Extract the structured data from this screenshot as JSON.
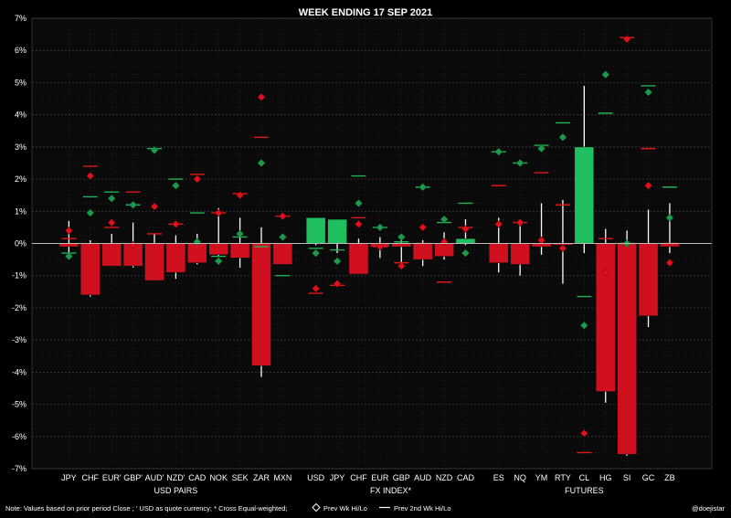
{
  "chart_data": {
    "type": "bar",
    "title": "WEEK ENDING  17 SEP 2021",
    "ylim": [
      -7,
      7
    ],
    "ytick_labels": [
      "-7%",
      "-6%",
      "-5%",
      "-4%",
      "-3%",
      "-2%",
      "-1%",
      "0%",
      "1%",
      "2%",
      "3%",
      "4%",
      "5%",
      "6%",
      "7%"
    ],
    "grid": true,
    "colors": {
      "up": "#1fbf5f",
      "down": "#d0101e",
      "diamond_up": "#1f9a4a",
      "diamond_down": "#e0101e",
      "background": "#000000",
      "plot": "#0a0a0a"
    },
    "groups": [
      {
        "label": "USD PAIRS",
        "categories": [
          "JPY",
          "CHF",
          "EUR'",
          "GBP'",
          "AUD'",
          "NZD'",
          "CAD",
          "NOK",
          "SEK",
          "ZAR",
          "MXN"
        ],
        "values": [
          -0.1,
          -1.6,
          -0.7,
          -0.7,
          -1.15,
          -0.9,
          -0.6,
          -0.35,
          -0.45,
          -3.8,
          -0.65
        ],
        "range_high": [
          0.7,
          0.1,
          0.3,
          0.65,
          0.3,
          0.25,
          0.3,
          1.1,
          0.8,
          0.5,
          0.0
        ],
        "range_low": [
          -0.3,
          -1.65,
          -0.7,
          -0.75,
          -1.15,
          -1.1,
          -0.65,
          -0.4,
          -0.75,
          -4.15,
          -0.65
        ],
        "prev_wk_high": [
          0.4,
          2.1,
          0.65,
          -0.05,
          1.15,
          0.6,
          2.0,
          0.95,
          1.5,
          4.55,
          0.85
        ],
        "prev_wk_low": [
          -0.4,
          0.95,
          1.4,
          1.2,
          2.9,
          1.8,
          0.05,
          -0.55,
          0.3,
          2.5,
          0.2
        ],
        "prev_2nd_wk_high": [
          0.15,
          2.4,
          0.5,
          1.6,
          0.3,
          0.6,
          2.15,
          0.95,
          1.55,
          3.3,
          0.85
        ],
        "prev_2nd_wk_low": [
          -0.3,
          1.45,
          1.6,
          1.2,
          2.95,
          2.0,
          0.95,
          -0.4,
          0.2,
          -0.1,
          -1.0
        ]
      },
      {
        "label": "FX INDEX*",
        "categories": [
          "USD",
          "JPY",
          "CHF",
          "EUR",
          "GBP",
          "AUD",
          "NZD",
          "CAD"
        ],
        "values": [
          0.8,
          0.75,
          -0.95,
          -0.1,
          -0.1,
          -0.5,
          -0.4,
          0.15
        ],
        "range_high": [
          0.8,
          0.75,
          0.15,
          0.2,
          0.2,
          0.1,
          0.35,
          0.75
        ],
        "range_low": [
          -0.05,
          -0.3,
          -0.95,
          -0.45,
          -0.75,
          -0.7,
          -0.5,
          -0.05
        ],
        "prev_wk_high": [
          -1.4,
          -1.25,
          0.6,
          -0.1,
          -0.7,
          0.5,
          0.05,
          0.45
        ],
        "prev_wk_low": [
          -0.3,
          -0.55,
          1.25,
          0.5,
          0.2,
          1.75,
          0.75,
          -0.3
        ],
        "prev_2nd_wk_high": [
          -1.55,
          -1.3,
          0.8,
          -0.1,
          -0.6,
          0.0,
          -1.2,
          0.5
        ],
        "prev_2nd_wk_low": [
          -0.15,
          -0.2,
          2.1,
          0.5,
          0.05,
          1.75,
          0.65,
          1.25
        ]
      },
      {
        "label": "FUTURES",
        "categories": [
          "ES",
          "NQ",
          "YM",
          "RTY",
          "CL",
          "HG",
          "SI",
          "GC",
          "ZB"
        ],
        "values": [
          -0.6,
          -0.65,
          -0.1,
          -0.05,
          3.0,
          -4.6,
          -6.55,
          -2.25,
          -0.1
        ],
        "range_high": [
          0.8,
          0.65,
          1.25,
          1.35,
          4.9,
          0.45,
          0.4,
          1.05,
          1.25
        ],
        "range_low": [
          -0.9,
          -1.0,
          -0.35,
          -1.25,
          -0.3,
          -4.95,
          -6.6,
          -2.6,
          -0.3
        ],
        "prev_wk_high": [
          0.6,
          0.65,
          0.1,
          -0.15,
          -5.9,
          -0.9,
          6.35,
          1.8,
          -0.6
        ],
        "prev_wk_low": [
          2.85,
          2.5,
          2.95,
          3.3,
          -2.55,
          5.25,
          0.0,
          4.7,
          0.8
        ],
        "prev_2nd_wk_high": [
          1.8,
          0.65,
          2.2,
          1.2,
          -6.5,
          0.15,
          6.4,
          2.95,
          0.0
        ],
        "prev_2nd_wk_low": [
          2.85,
          2.5,
          3.05,
          3.75,
          -1.65,
          4.05,
          0.0,
          4.9,
          1.75
        ]
      }
    ],
    "note": "Note:  Values based on prior period Close ;  ' USD as quote currency;  * Cross Equal-weighted;",
    "legend_prev_wk": "Prev Wk Hi/Lo",
    "legend_prev_2nd_wk": "Prev 2nd Wk Hi/Lo",
    "credit": "@doejistar"
  }
}
